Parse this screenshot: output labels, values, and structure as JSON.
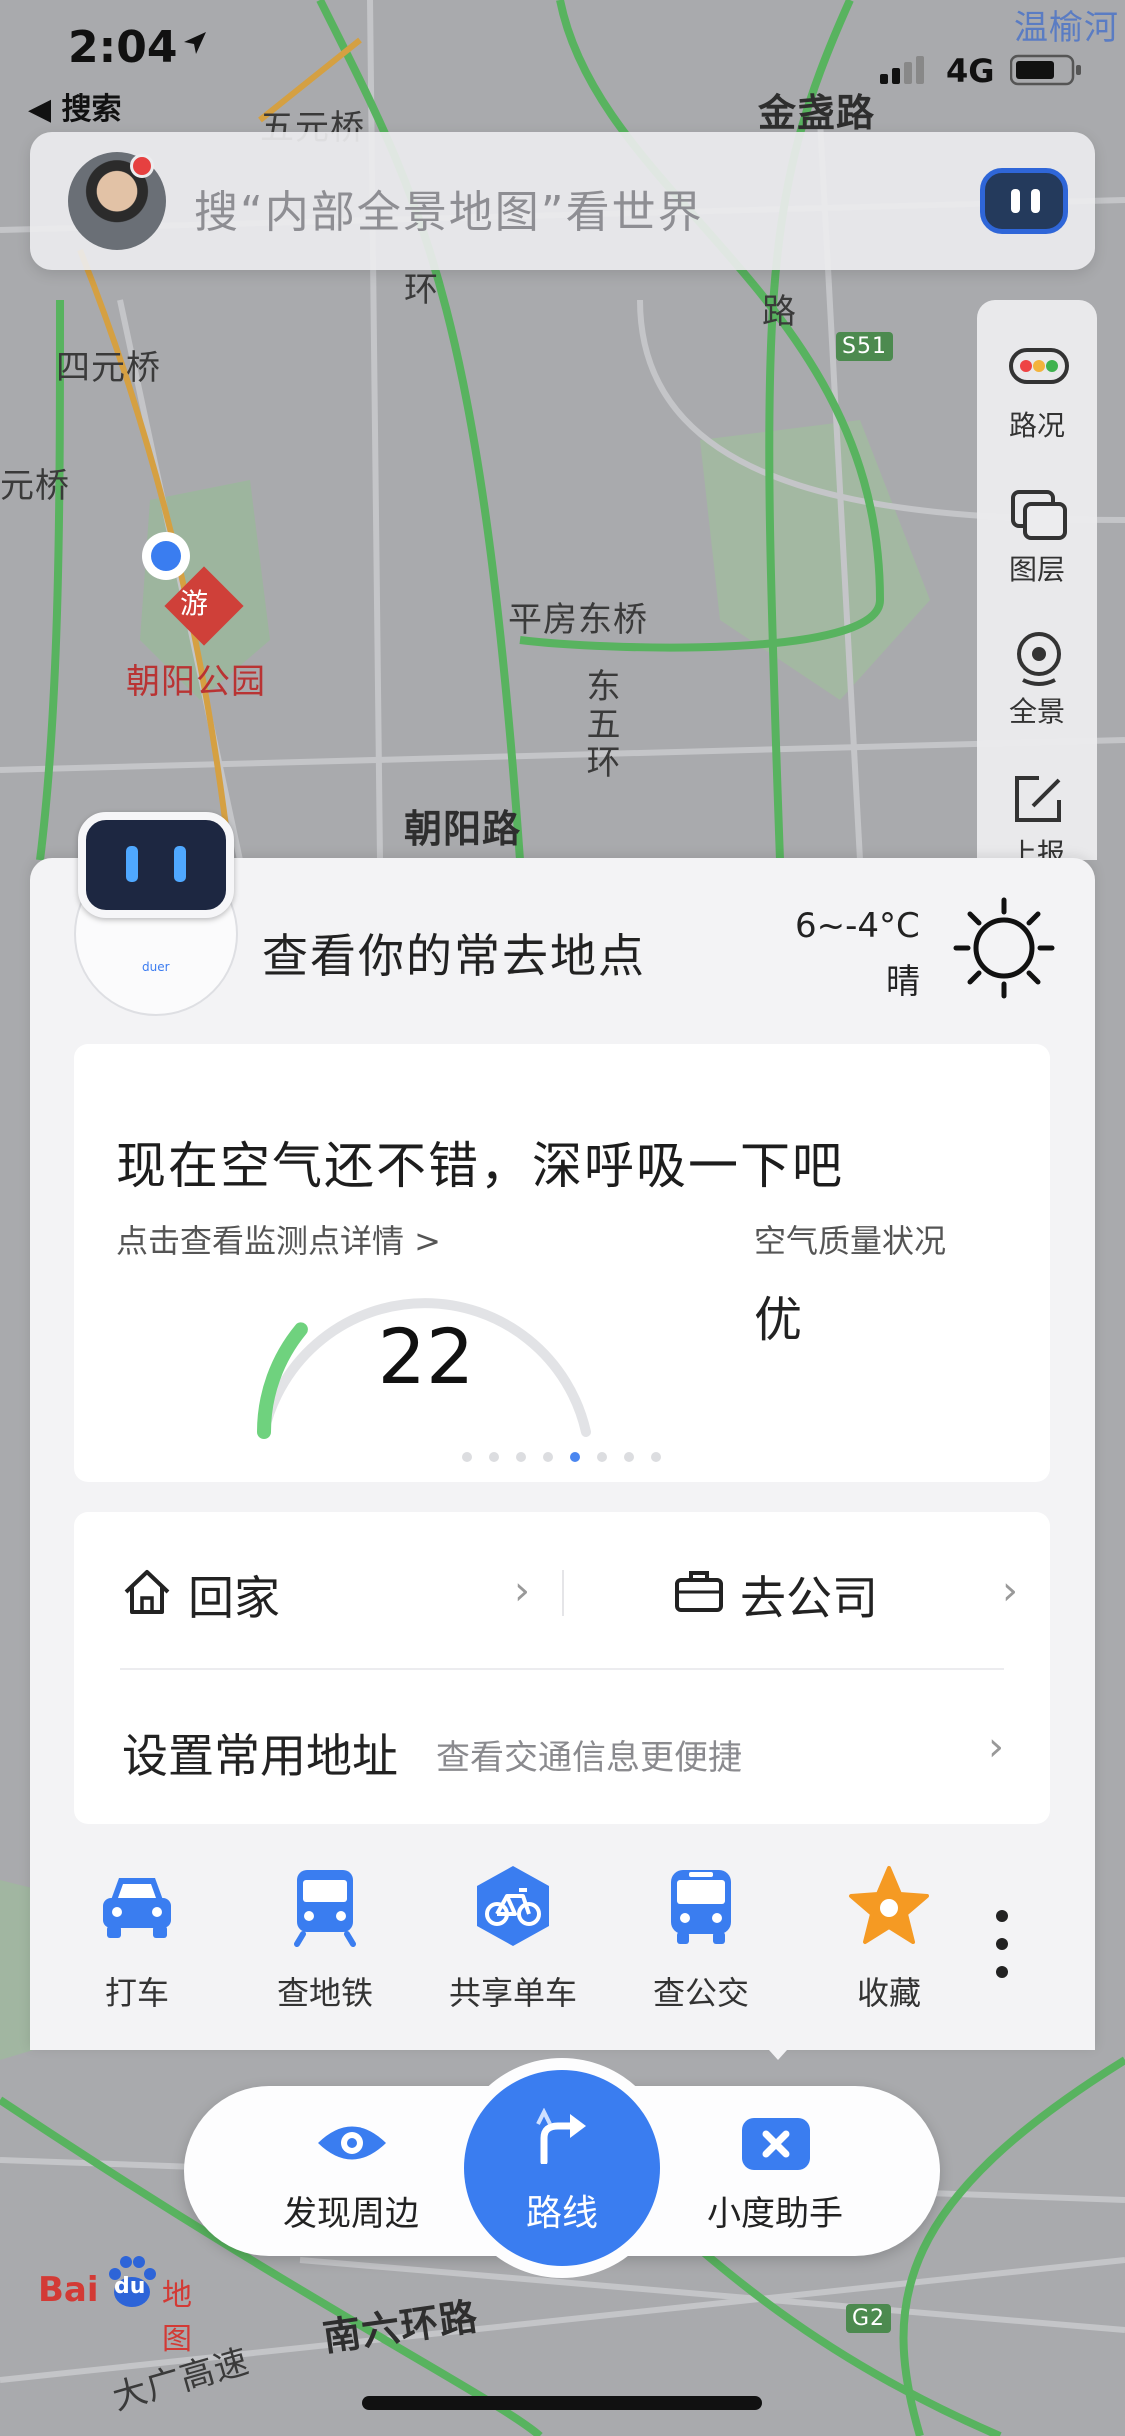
{
  "status_bar": {
    "time": "2:04",
    "back_label": "◀ 搜索",
    "network": "4G"
  },
  "search": {
    "placeholder": "搜“内部全景地图”看世界"
  },
  "map": {
    "labels": {
      "wuyuanqiao": "五元桥",
      "jinzhanlu": "金盏路",
      "siyuanqiao": "四元桥",
      "yuanqiao": "元桥",
      "chaoyang_park": "朝阳公园",
      "pingfang_dongqiao": "平房东桥",
      "dongwuhuan": "东五环",
      "chaoyanglu": "朝阳路",
      "wenyu": "温榆河",
      "lu": "路",
      "huan": "环",
      "nanliuhuanlu": "南六环路",
      "daguang": "大广高速",
      "s51": "S51",
      "g2": "G2",
      "you": "游"
    }
  },
  "tools": {
    "traffic": "路况",
    "layers": "图层",
    "panorama": "全景",
    "report": "上报"
  },
  "assistant_card": {
    "robot_tag": "duer",
    "greeting": "查看你的常去地点",
    "weather_temp": "6~-4°C",
    "weather_cond": "晴"
  },
  "air_quality": {
    "headline": "现在空气还不错，深呼吸一下吧",
    "details_link": "点击查看监测点详情 >",
    "status_label": "空气质量状况",
    "status_value": "优",
    "aqi": "22",
    "aqi_fraction": 0.22,
    "page_count": 8,
    "active_page": 5
  },
  "addresses": {
    "home_label": "回家",
    "work_label": "去公司",
    "set_label": "设置常用地址",
    "set_hint": "查看交通信息更便捷",
    "chevron": "›"
  },
  "quick_actions": [
    {
      "label": "打车",
      "icon": "taxi-icon",
      "color": "#3a7df0"
    },
    {
      "label": "查地铁",
      "icon": "subway-icon",
      "color": "#3a7df0"
    },
    {
      "label": "共享单车",
      "icon": "bike-icon",
      "color": "#3a7df0"
    },
    {
      "label": "查公交",
      "icon": "bus-icon",
      "color": "#3a7df0"
    },
    {
      "label": "收藏",
      "icon": "star-icon",
      "color": "#f59a23"
    }
  ],
  "bottom_tabs": {
    "discover": "发现周边",
    "route": "路线",
    "assistant": "小度助手"
  },
  "brand": {
    "bai": "Bai",
    "du": "du",
    "map": "地图"
  },
  "colors": {
    "accent": "#3a7df0",
    "aqi_good": "#6fd27e",
    "favorite": "#f59a23"
  }
}
